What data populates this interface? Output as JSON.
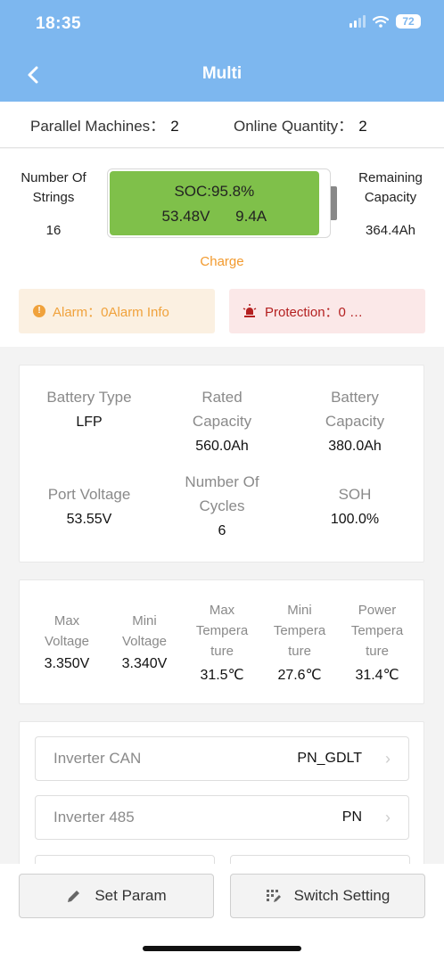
{
  "status": {
    "time": "18:35",
    "battery": "72"
  },
  "header": {
    "title": "Multi"
  },
  "summary": {
    "parallel_label": "Parallel Machines：",
    "parallel_value": "2",
    "online_label": "Online Quantity：",
    "online_value": "2"
  },
  "pack": {
    "strings_label_1": "Number Of",
    "strings_label_2": "Strings",
    "strings_value": "16",
    "soc_text": "SOC:95.8%",
    "soc_fraction": 0.958,
    "voltage": "53.48V",
    "current": "9.4A",
    "remaining_label_1": "Remaining",
    "remaining_label_2": "Capacity",
    "remaining_value": "364.4Ah",
    "state": "Charge",
    "alarm_text": "Alarm：0Alarm Info",
    "protection_text": "Protection：0 …"
  },
  "info": {
    "battery_type_label": "Battery Type",
    "battery_type_value": "LFP",
    "rated_label_1": "Rated",
    "rated_label_2": "Capacity",
    "rated_value": "560.0Ah",
    "batcap_label_1": "Battery",
    "batcap_label_2": "Capacity",
    "batcap_value": "380.0Ah",
    "port_label": "Port Voltage",
    "port_value": "53.55V",
    "cycles_label_1": "Number Of",
    "cycles_label_2": "Cycles",
    "cycles_value": "6",
    "soh_label": "SOH",
    "soh_value": "100.0%"
  },
  "cells": [
    {
      "l1": "Max",
      "l2": "Voltage",
      "l3": "",
      "value": "3.350V"
    },
    {
      "l1": "Mini",
      "l2": "Voltage",
      "l3": "",
      "value": "3.340V"
    },
    {
      "l1": "Max",
      "l2": "Tempera",
      "l3": "ture",
      "value": "31.5℃"
    },
    {
      "l1": "Mini",
      "l2": "Tempera",
      "l3": "ture",
      "value": "27.6℃"
    },
    {
      "l1": "Power",
      "l2": "Tempera",
      "l3": "ture",
      "value": "31.4℃"
    }
  ],
  "settings": {
    "rows": [
      {
        "label": "Inverter CAN",
        "value": "PN_GDLT"
      },
      {
        "label": "Inverter 485",
        "value": "PN"
      }
    ]
  },
  "actions": {
    "set_param": "Set Param",
    "switch_setting": "Switch Setting"
  },
  "colors": {
    "header": "#7db7ef",
    "soc_fill": "#7fc04a",
    "charge": "#f29a2e",
    "protection": "#b42020"
  }
}
